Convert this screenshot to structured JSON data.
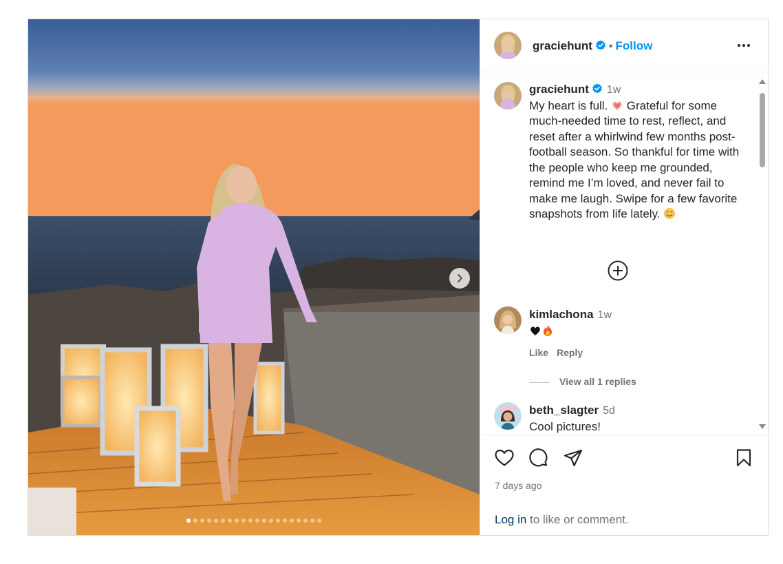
{
  "author": {
    "username": "graciehunt",
    "follow_label": "Follow",
    "separator": "•"
  },
  "caption": {
    "username": "graciehunt",
    "time": "1w",
    "text_part1": "My heart is full.",
    "text_part2": "Grateful for some much-needed time to rest, reflect, and reset after a whirlwind few months post-football season. So thankful for time with the people who keep me grounded, remind me I’m loved, and never fail to make me laugh. Swipe for a few favorite snapshots from life lately."
  },
  "comments": [
    {
      "username": "kimlachona",
      "time": "1w",
      "text": "",
      "like_label": "Like",
      "reply_label": "Reply",
      "view_replies_label": "View all 1 replies"
    },
    {
      "username": "beth_slagter",
      "time": "5d",
      "text": "Cool pictures!"
    }
  ],
  "footer": {
    "posted_ago": "7 days ago",
    "login_link": "Log in",
    "login_rest": " to like or comment."
  },
  "carousel": {
    "total_slides": 20,
    "active_index": 0
  },
  "icons": [
    "verified-badge-icon",
    "more-options-icon",
    "chevron-right-icon",
    "add-circle-icon",
    "heart-icon",
    "comment-icon",
    "share-icon",
    "bookmark-icon",
    "black-heart-emoji",
    "fire-emoji",
    "heart-hands-emoji",
    "smiling-emoji"
  ],
  "colors": {
    "accent": "#0095f6",
    "verified": "#0095f6",
    "link_dark": "#00376b",
    "muted": "#737373"
  }
}
